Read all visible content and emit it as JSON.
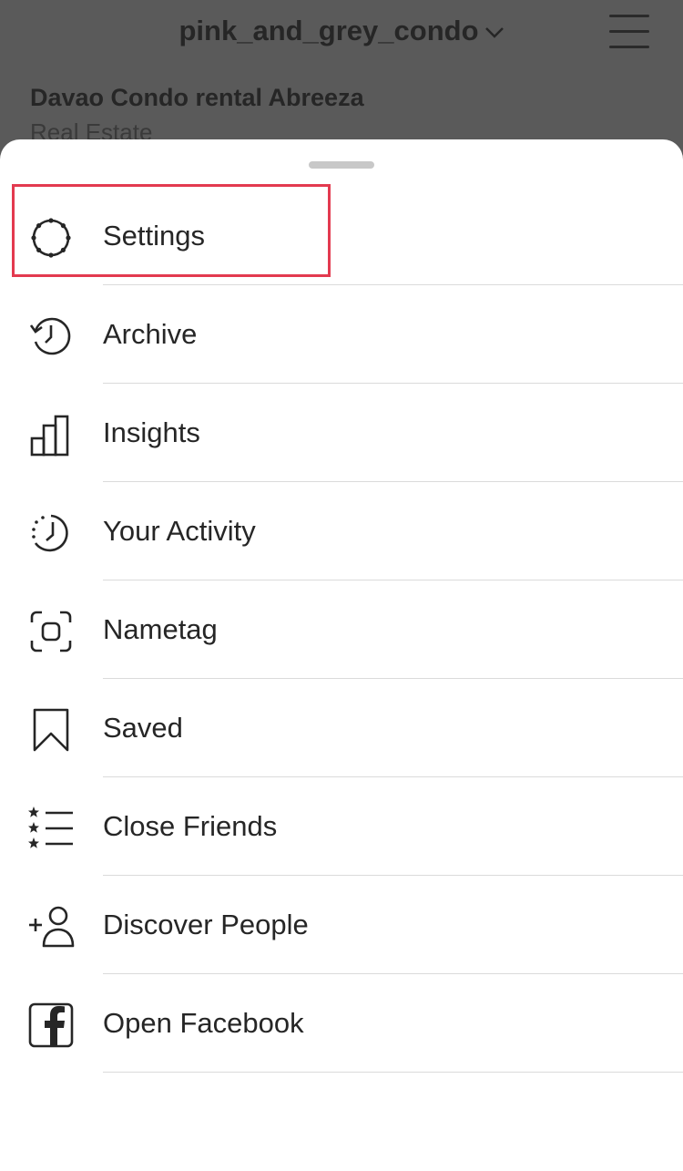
{
  "header": {
    "username": "pink_and_grey_condo",
    "dropdown_icon": "chevron-down-icon",
    "menu_icon": "hamburger-menu-icon"
  },
  "profile": {
    "name": "Davao Condo rental Abreeza",
    "category": "Real Estate"
  },
  "menu": {
    "items": [
      {
        "label": "Settings",
        "icon": "settings-gear-icon"
      },
      {
        "label": "Archive",
        "icon": "archive-history-icon"
      },
      {
        "label": "Insights",
        "icon": "insights-bar-chart-icon"
      },
      {
        "label": "Your Activity",
        "icon": "activity-clock-icon"
      },
      {
        "label": "Nametag",
        "icon": "nametag-scan-icon"
      },
      {
        "label": "Saved",
        "icon": "bookmark-icon"
      },
      {
        "label": "Close Friends",
        "icon": "close-friends-list-icon"
      },
      {
        "label": "Discover People",
        "icon": "add-person-icon"
      },
      {
        "label": "Open Facebook",
        "icon": "facebook-icon"
      }
    ],
    "highlighted_item": "Settings"
  },
  "colors": {
    "backdrop": "#5a5a5a",
    "sheet": "#ffffff",
    "text": "#262626",
    "divider": "#dbdbdb",
    "highlight": "#e33a4f"
  }
}
